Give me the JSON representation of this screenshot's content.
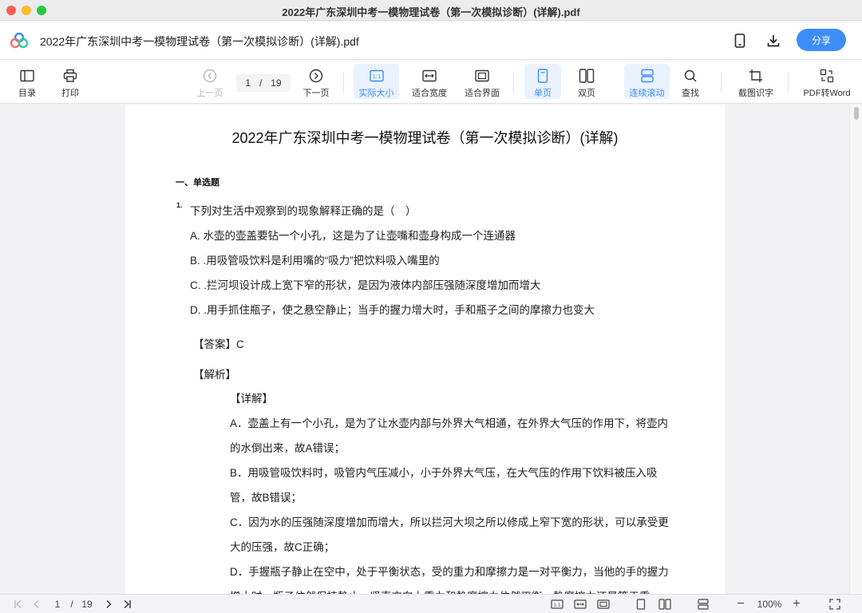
{
  "window": {
    "title": "2022年广东深圳中考一模物理试卷（第一次模拟诊断）(详解).pdf"
  },
  "header": {
    "doc_title": "2022年广东深圳中考一模物理试卷（第一次模拟诊断）(详解).pdf",
    "share_label": "分享",
    "icons": [
      "app-logo",
      "phone-icon",
      "download-icon"
    ]
  },
  "toolbar": {
    "toc": "目录",
    "print": "打印",
    "prev_page": "上一页",
    "current_page": "1",
    "page_sep": "/",
    "total_pages": "19",
    "next_page": "下一页",
    "actual_size": "实际大小",
    "fit_width": "适合宽度",
    "fit_screen": "适合界面",
    "single_page": "单页",
    "double_page": "双页",
    "continuous_scroll": "连续滚动",
    "search": "查找",
    "screenshot_ocr": "截图识字",
    "pdf_to_word": "PDF转Word"
  },
  "document": {
    "title": "2022年广东深圳中考一模物理试卷（第一次模拟诊断）(详解)",
    "section": "一、单选题",
    "question_number": "1.",
    "question": "下列对生活中观察到的现象解释正确的是（　）",
    "options": [
      "A. 水壶的壶盖要钻一个小孔，这是为了让壶嘴和壶身构成一个连通器",
      "B. .用吸管吸饮料是利用嘴的“吸力”把饮料吸入嘴里的",
      "C. .拦河坝设计成上宽下窄的形状，是因为液体内部压强随深度增加而增大",
      "D. .用手抓住瓶子，使之悬空静止；当手的握力增大时，手和瓶子之间的摩擦力也变大"
    ],
    "answer_label": "【答案】",
    "answer_value": "C",
    "analysis_label": "【解析】",
    "detail_label": "【详解】",
    "detail_lines": [
      "A．壶盖上有一个小孔，是为了让水壶内部与外界大气相通，在外界大气压的作用下，将壶内",
      "的水倒出来，故A错误；",
      "B．用吸管吸饮料时，吸管内气压减小，小于外界大气压，在大气压的作用下饮料被压入吸",
      "管，故B错误；",
      "C．因为水的压强随深度增加而增大，所以拦河大坝之所以修成上窄下宽的形状，可以承受更",
      "大的压强，故C正确；",
      "D．手握瓶子静止在空中，处于平衡状态，受的重力和摩擦力是一对平衡力，当他的手的握力",
      "增大时，瓶子依然保持静止，竖直方向上重力和静摩擦力依然平衡，静摩擦力还是等于重"
    ]
  },
  "statusbar": {
    "current_page": "1",
    "page_sep": "/",
    "total_pages": "19",
    "zoom": "100%",
    "zoom_out": "−",
    "zoom_in": "+"
  },
  "colors": {
    "accent": "#3d8ef7",
    "active_bg": "#eaf2fe",
    "page_bg": "#ffffff",
    "viewer_bg": "#f2f2f4"
  }
}
